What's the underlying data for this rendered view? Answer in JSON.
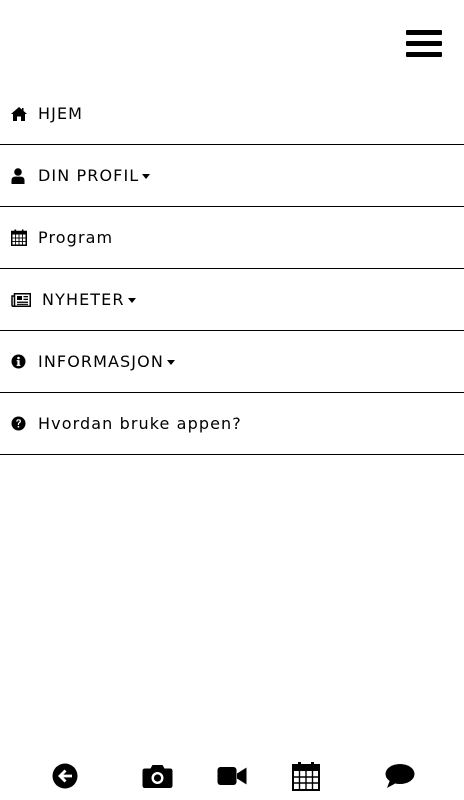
{
  "header": {
    "menu_icon": "hamburger-menu-icon"
  },
  "menu": {
    "items": [
      {
        "label": "HJEM",
        "icon": "home-icon",
        "dropdown": false
      },
      {
        "label": "DIN PROFIL",
        "icon": "user-icon",
        "dropdown": true
      },
      {
        "label": "Program",
        "icon": "calendar-icon",
        "dropdown": false
      },
      {
        "label": "NYHETER",
        "icon": "newspaper-icon",
        "dropdown": true
      },
      {
        "label": "INFORMASJON",
        "icon": "info-circle-icon",
        "dropdown": true
      },
      {
        "label": "Hvordan bruke appen?",
        "icon": "question-circle-icon",
        "dropdown": false
      }
    ]
  },
  "bottom_nav": {
    "buttons": [
      {
        "icon": "back-arrow-icon"
      },
      {
        "icon": "camera-icon"
      },
      {
        "icon": "video-camera-icon"
      },
      {
        "icon": "calendar-icon"
      },
      {
        "icon": "chat-bubble-icon"
      }
    ]
  },
  "colors": {
    "background": "#ffffff",
    "foreground": "#000000"
  }
}
